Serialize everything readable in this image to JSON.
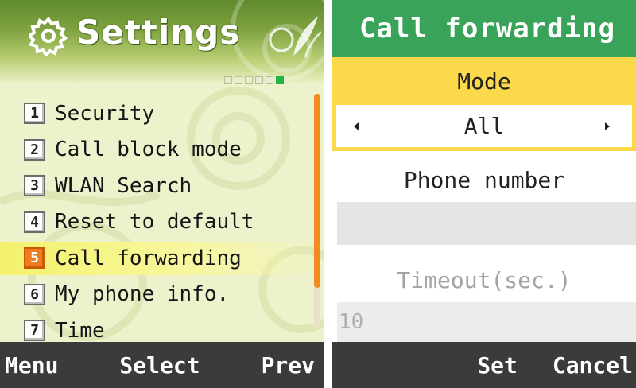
{
  "settings": {
    "title": "Settings",
    "page_indicator": {
      "total": 6,
      "current": 6
    },
    "items": [
      {
        "number": "1",
        "label": "Security"
      },
      {
        "number": "2",
        "label": "Call block mode"
      },
      {
        "number": "3",
        "label": "WLAN Search"
      },
      {
        "number": "4",
        "label": "Reset to default"
      },
      {
        "number": "5",
        "label": "Call forwarding",
        "selected": true
      },
      {
        "number": "6",
        "label": "My phone info."
      },
      {
        "number": "7",
        "label": "Time"
      }
    ],
    "softkeys": {
      "left": "Menu",
      "center": "Select",
      "right": "Prev"
    },
    "colors": {
      "header": "#7ea23f",
      "highlight": "#f4f26a",
      "selected_number": "#f07d1d",
      "scroll_thumb": "#f28a1f",
      "softkey_bar": "#3b3b3b"
    },
    "icons": [
      "gear-icon",
      "leaf-decoration-icon"
    ]
  },
  "call_forwarding": {
    "title": "Call forwarding",
    "mode_label": "Mode",
    "mode_value": "All",
    "phone_label": "Phone number",
    "phone_value": "",
    "timeout_label": "Timeout(sec.)",
    "timeout_value": "10",
    "softkeys": {
      "center": "Set",
      "right": "Cancel"
    },
    "colors": {
      "title_bar": "#3aa35a",
      "mode_bar": "#fbd94a",
      "input_bg": "#e5e5e5"
    },
    "icons": [
      "arrow-left-icon",
      "arrow-right-icon"
    ]
  }
}
